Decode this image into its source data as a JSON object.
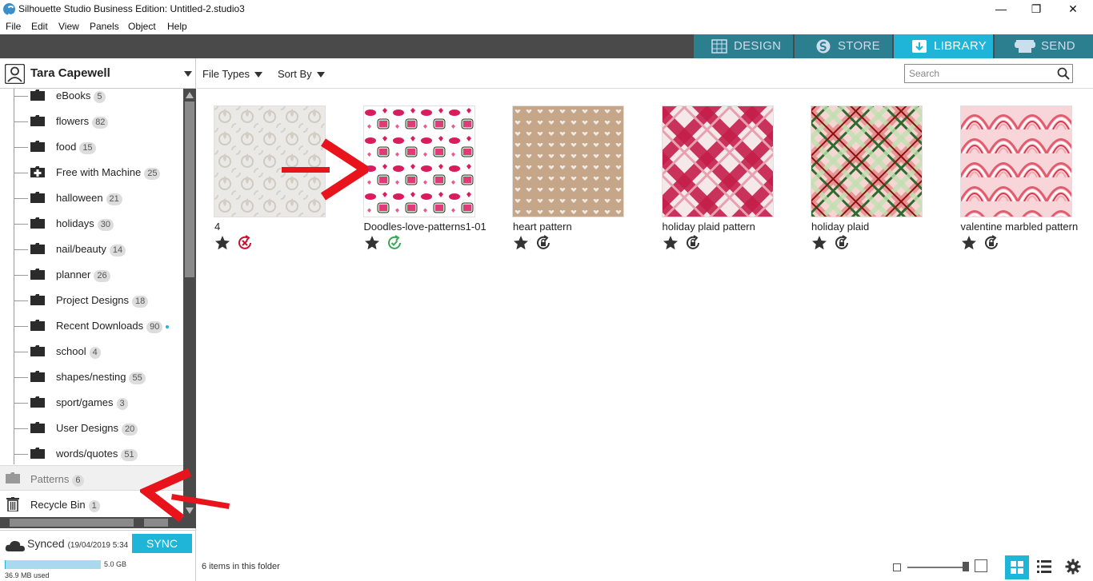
{
  "window": {
    "title": "Silhouette Studio Business Edition: Untitled-2.studio3",
    "minimize": "—",
    "maximize": "❐",
    "close": "✕"
  },
  "menu": [
    "File",
    "Edit",
    "View",
    "Panels",
    "Object",
    "Help"
  ],
  "tabs": [
    {
      "label": "DESIGN",
      "icon": "design-grid-icon",
      "active": false
    },
    {
      "label": "STORE",
      "icon": "store-icon",
      "active": false
    },
    {
      "label": "LIBRARY",
      "icon": "library-download-icon",
      "active": true
    },
    {
      "label": "SEND",
      "icon": "send-cutter-icon",
      "active": false
    }
  ],
  "colors": {
    "accent": "#1fb5d8",
    "tab_inactive": "#2b7f8f",
    "dark_bar": "#4a4a4a",
    "arrow": "#e8131b"
  },
  "user": {
    "name": "Tara Capewell"
  },
  "folders": [
    {
      "label": "eBooks",
      "count": "5",
      "icon": "folder-icon"
    },
    {
      "label": "flowers",
      "count": "82",
      "icon": "folder-icon"
    },
    {
      "label": "food",
      "count": "15",
      "icon": "folder-icon"
    },
    {
      "label": "Free with Machine",
      "count": "25",
      "icon": "folder-plus-icon"
    },
    {
      "label": "halloween",
      "count": "21",
      "icon": "folder-icon"
    },
    {
      "label": "holidays",
      "count": "30",
      "icon": "folder-icon"
    },
    {
      "label": "nail/beauty",
      "count": "14",
      "icon": "folder-icon"
    },
    {
      "label": "planner",
      "count": "26",
      "icon": "folder-icon"
    },
    {
      "label": "Project Designs",
      "count": "18",
      "icon": "folder-icon"
    },
    {
      "label": "Recent Downloads",
      "count": "90",
      "icon": "folder-icon"
    },
    {
      "label": "school",
      "count": "4",
      "icon": "folder-icon"
    },
    {
      "label": "shapes/nesting",
      "count": "55",
      "icon": "folder-icon"
    },
    {
      "label": "sport/games",
      "count": "3",
      "icon": "folder-icon"
    },
    {
      "label": "User Designs",
      "count": "20",
      "icon": "folder-icon"
    },
    {
      "label": "words/quotes",
      "count": "51",
      "icon": "folder-icon"
    }
  ],
  "patterns_folder": {
    "label": "Patterns",
    "count": "6"
  },
  "recycle_bin": {
    "label": "Recycle Bin",
    "count": "1"
  },
  "sync": {
    "status": "Synced",
    "date": "(19/04/2019 5:34",
    "button": "SYNC",
    "capacity": "5.0 GB",
    "used": "36.9 MB used",
    "used_fraction": 0.007
  },
  "toolbar": {
    "file_types": "File Types",
    "sort_by": "Sort By",
    "search_placeholder": "Search"
  },
  "items": [
    {
      "name": "4",
      "pattern": "damask-gray",
      "status": "sync-error-icon"
    },
    {
      "name": "Doodles-love-patterns1-01",
      "pattern": "kiss-lips",
      "status": "sync-ok-icon"
    },
    {
      "name": "heart pattern",
      "pattern": "hearts-tan",
      "status": "locked-sync-icon"
    },
    {
      "name": "holiday plaid pattern",
      "pattern": "plaid-red",
      "status": "locked-sync-icon"
    },
    {
      "name": "holiday plaid",
      "pattern": "plaid-green",
      "status": "locked-sync-icon"
    },
    {
      "name": "valentine marbled pattern",
      "pattern": "marbled-pink",
      "status": "locked-sync-icon"
    }
  ],
  "status": {
    "count_text": "6 items in this folder"
  }
}
